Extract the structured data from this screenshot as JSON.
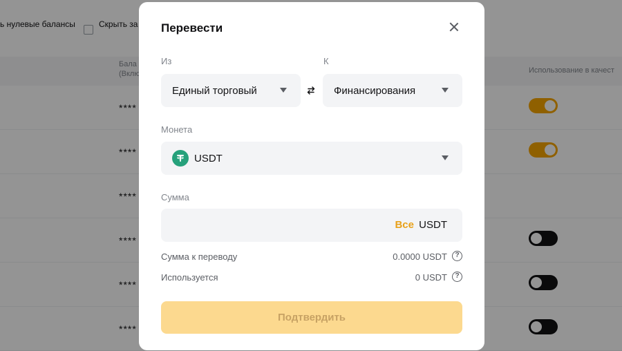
{
  "background": {
    "filter_zero_balances": "ь нулевые балансы",
    "filter_hide": "Скрыть за",
    "column_balance_line1": "Бала",
    "column_balance_line2": "(Вклю",
    "column_collateral": "Использование в качест",
    "rows": [
      {
        "stars": "****",
        "toggle": "on"
      },
      {
        "stars": "****",
        "toggle": "on"
      },
      {
        "stars": "****",
        "toggle": "none"
      },
      {
        "stars": "****",
        "toggle": "off"
      },
      {
        "stars": "****",
        "toggle": "off"
      },
      {
        "stars": "****",
        "toggle": "off"
      }
    ]
  },
  "modal": {
    "title": "Перевести",
    "from_label": "Из",
    "from_value": "Единый торговый",
    "to_label": "К",
    "to_value": "Финансирования",
    "coin_label": "Монета",
    "coin_value": "USDT",
    "amount_label": "Сумма",
    "amount_value": "",
    "amount_all": "Все",
    "amount_currency": "USDT",
    "transfer_amount_label": "Сумма к переводу",
    "transfer_amount_value": "0.0000 USDT",
    "used_label": "Используется",
    "used_value": "0 USDT",
    "confirm_label": "Подтвердить"
  },
  "colors": {
    "accent": "#f7a600",
    "confirm_disabled_bg": "#fcd98f",
    "coin_green": "#26a17b"
  },
  "icons": {
    "close": "close-icon",
    "swap": "swap-arrows-icon",
    "caret": "caret-down-icon",
    "coin": "tether-icon",
    "help": "question-circle-icon"
  }
}
